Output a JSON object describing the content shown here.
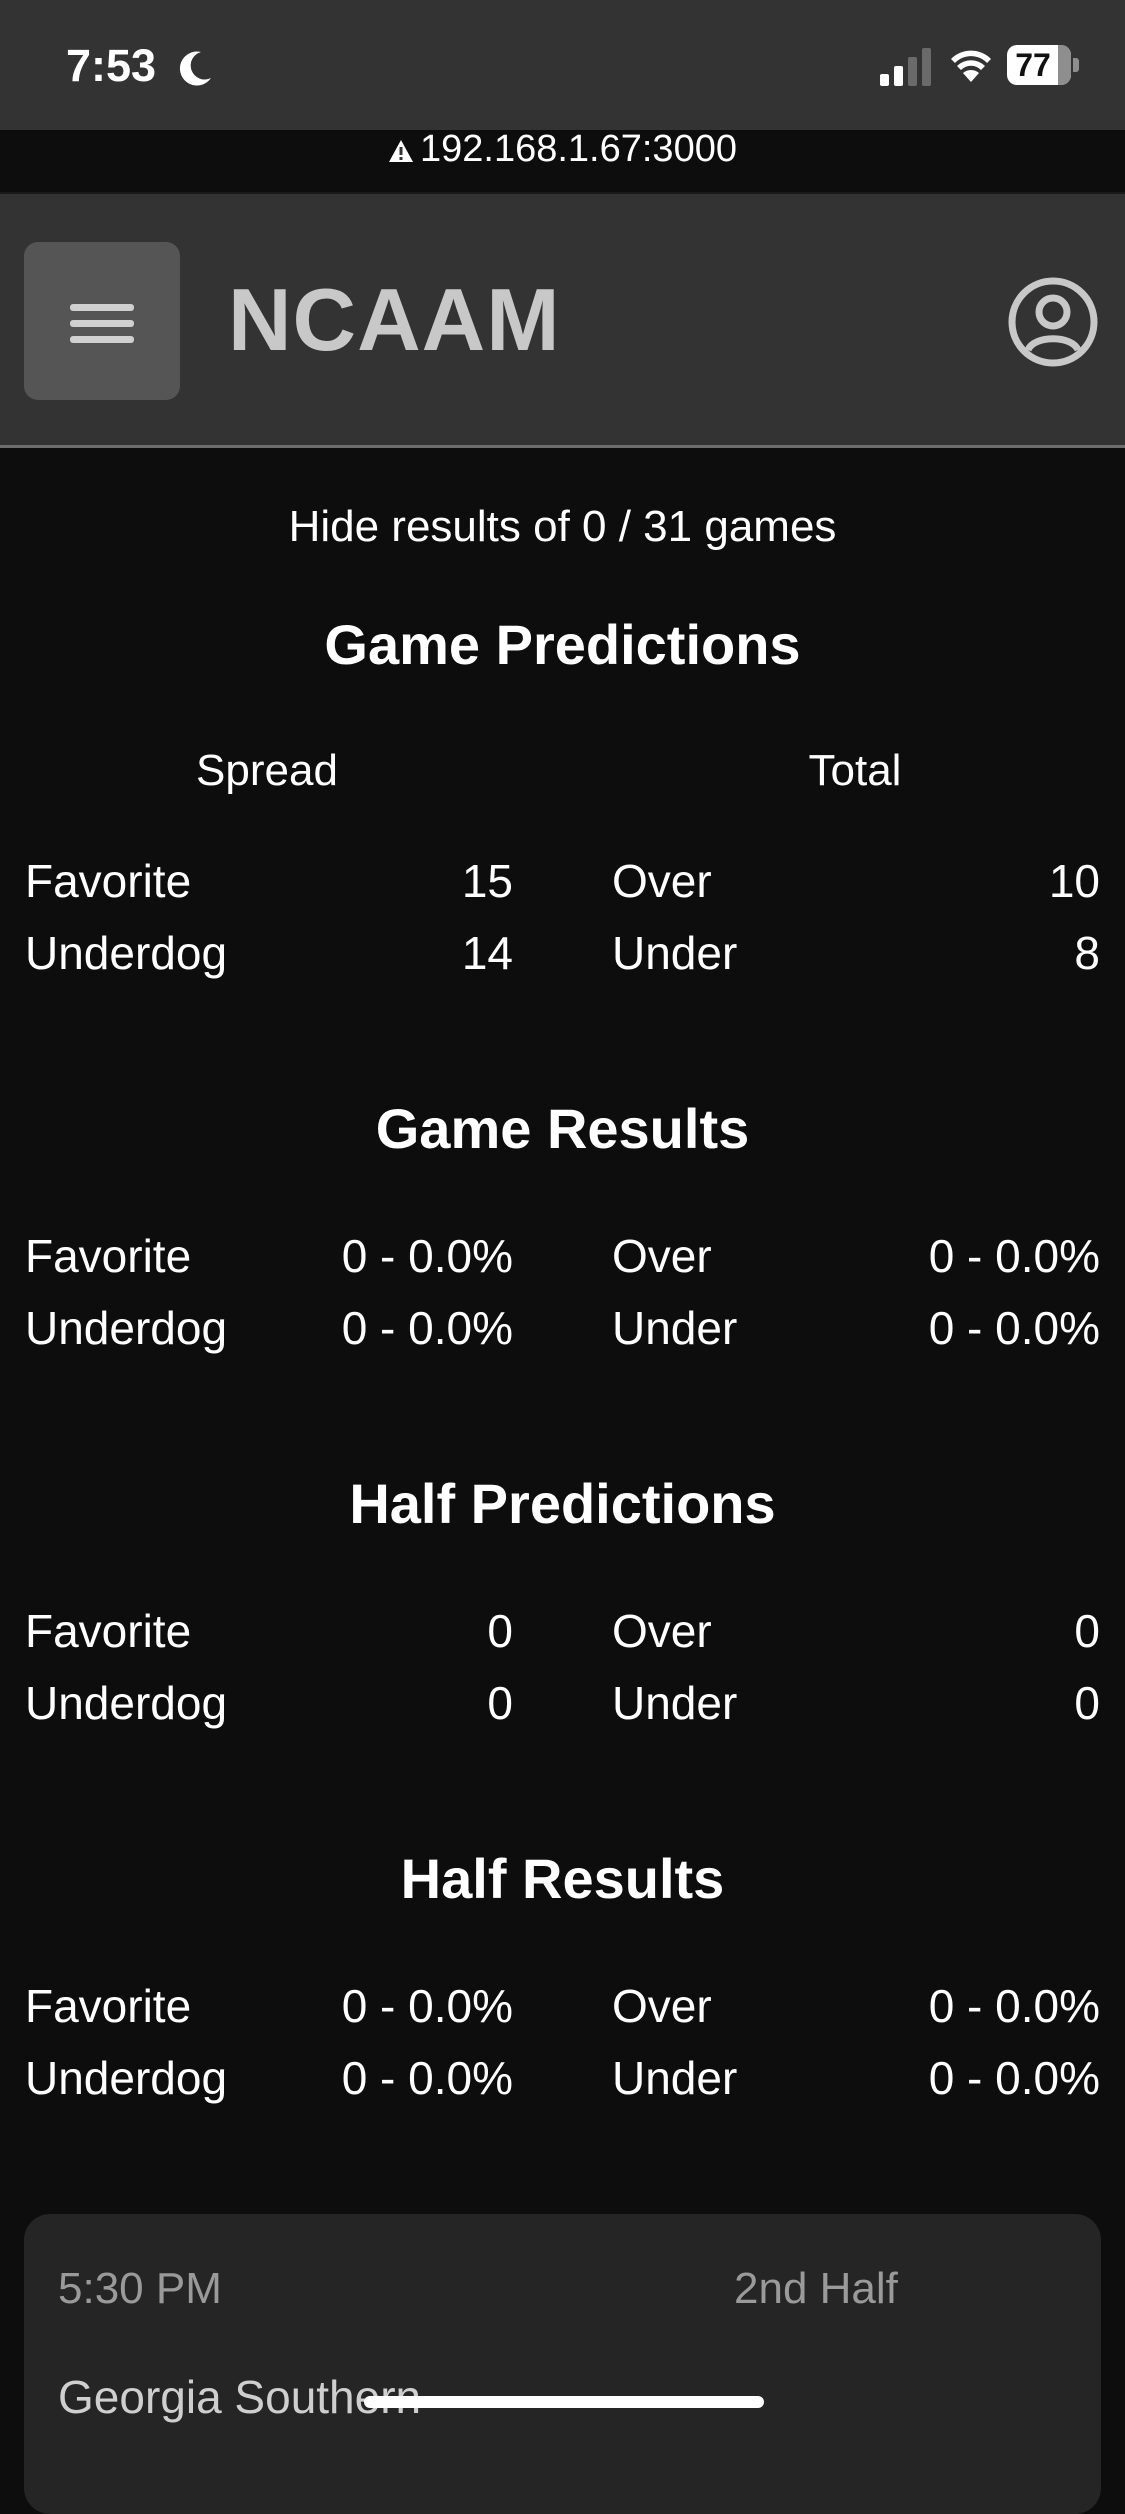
{
  "status_bar": {
    "time": "7:53",
    "battery": "77"
  },
  "url": "192.168.1.67:3000",
  "header": {
    "title": "NCAAM"
  },
  "hide_results": "Hide results of 0 / 31 games",
  "game_predictions": {
    "title": "Game Predictions",
    "spread_header": "Spread",
    "total_header": "Total",
    "rows": [
      {
        "left_label": "Favorite",
        "left_value": "15",
        "right_label": "Over",
        "right_value": "10"
      },
      {
        "left_label": "Underdog",
        "left_value": "14",
        "right_label": "Under",
        "right_value": "8"
      }
    ]
  },
  "game_results": {
    "title": "Game Results",
    "rows": [
      {
        "left_label": "Favorite",
        "left_value": "0 - 0.0%",
        "right_label": "Over",
        "right_value": "0 - 0.0%"
      },
      {
        "left_label": "Underdog",
        "left_value": "0 - 0.0%",
        "right_label": "Under",
        "right_value": "0 - 0.0%"
      }
    ]
  },
  "half_predictions": {
    "title": "Half Predictions",
    "rows": [
      {
        "left_label": "Favorite",
        "left_value": "0",
        "right_label": "Over",
        "right_value": "0"
      },
      {
        "left_label": "Underdog",
        "left_value": "0",
        "right_label": "Under",
        "right_value": "0"
      }
    ]
  },
  "half_results": {
    "title": "Half Results",
    "rows": [
      {
        "left_label": "Favorite",
        "left_value": "0 - 0.0%",
        "right_label": "Over",
        "right_value": "0 - 0.0%"
      },
      {
        "left_label": "Underdog",
        "left_value": "0 - 0.0%",
        "right_label": "Under",
        "right_value": "0 - 0.0%"
      }
    ]
  },
  "game_card": {
    "time": "5:30 PM",
    "period": "2nd Half",
    "team": "Georgia Southern"
  },
  "icons": {
    "menu": "hamburger-menu-icon",
    "user": "user-circle-icon",
    "moon": "moon-icon",
    "signal": "cellular-signal-icon",
    "wifi": "wifi-icon",
    "battery": "battery-icon",
    "warning": "warning-icon"
  },
  "colors": {
    "background": "#0d0d0d",
    "header": "#333333",
    "card": "#252525",
    "menu_button": "#555555"
  }
}
